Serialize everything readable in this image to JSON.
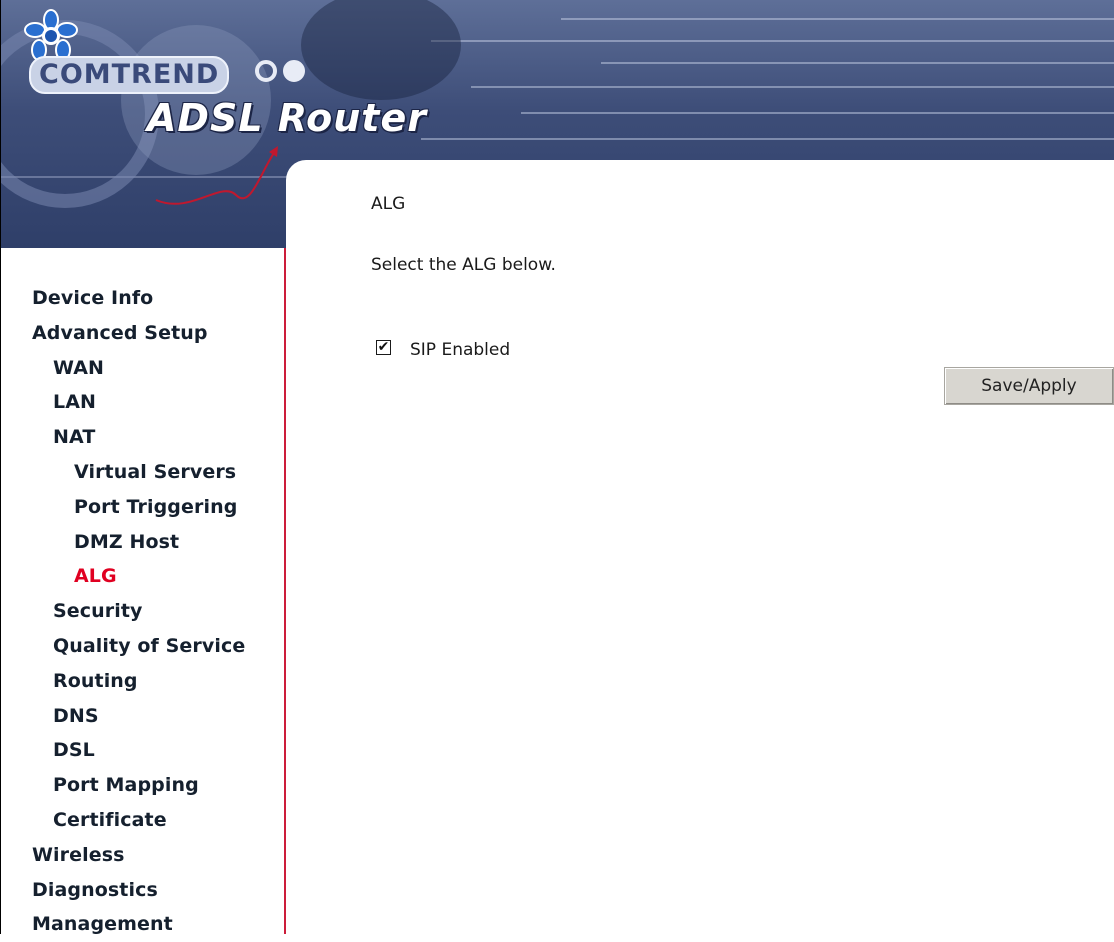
{
  "header": {
    "brand": "COMTREND",
    "product": "ADSL Router"
  },
  "sidebar": {
    "items": [
      {
        "label": "Device Info",
        "level": 0
      },
      {
        "label": "Advanced Setup",
        "level": 0
      },
      {
        "label": "WAN",
        "level": 1
      },
      {
        "label": "LAN",
        "level": 1
      },
      {
        "label": "NAT",
        "level": 1
      },
      {
        "label": "Virtual Servers",
        "level": 2
      },
      {
        "label": "Port Triggering",
        "level": 2
      },
      {
        "label": "DMZ Host",
        "level": 2
      },
      {
        "label": "ALG",
        "level": 2,
        "active": true
      },
      {
        "label": "Security",
        "level": 1
      },
      {
        "label": "Quality of Service",
        "level": 1
      },
      {
        "label": "Routing",
        "level": 1
      },
      {
        "label": "DNS",
        "level": 1
      },
      {
        "label": "DSL",
        "level": 1
      },
      {
        "label": "Port Mapping",
        "level": 1
      },
      {
        "label": "Certificate",
        "level": 1
      },
      {
        "label": "Wireless",
        "level": 0
      },
      {
        "label": "Diagnostics",
        "level": 0
      },
      {
        "label": "Management",
        "level": 0
      }
    ],
    "active_color": "#e00021",
    "border_color": "#cc1d3a"
  },
  "main": {
    "title": "ALG",
    "description": "Select the ALG below.",
    "sip_checkbox": {
      "label": "SIP Enabled",
      "checked": true,
      "check_glyph": "✔"
    },
    "save_button_label": "Save/Apply"
  }
}
